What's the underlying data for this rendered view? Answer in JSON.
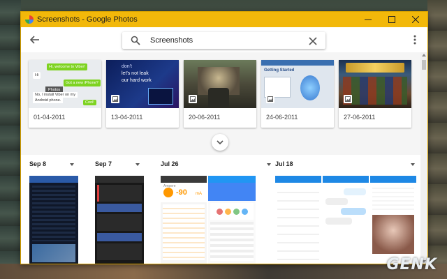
{
  "window": {
    "title": "Screenshots - Google Photos"
  },
  "toolbar": {
    "search_value": "Screenshots"
  },
  "albums": [
    {
      "date": "01-04-2011",
      "thumb_text": [
        "Hi, welcome to Viber!",
        "Hi",
        "Got a new iPhone?",
        "Photos",
        "No, I install Viber on my",
        "Android phone.",
        "Cool!"
      ]
    },
    {
      "date": "13-04-2011",
      "thumb_text": [
        "don't",
        "let's not leak",
        "our hard work"
      ]
    },
    {
      "date": "20-06-2011"
    },
    {
      "date": "24-06-2011",
      "thumb_text": [
        "Getting Started"
      ]
    },
    {
      "date": "27-06-2011"
    }
  ],
  "date_groups": [
    {
      "label": "Sep 8"
    },
    {
      "label": "Sep 7"
    },
    {
      "label": "Jul 26"
    },
    {
      "label": "Jul 18"
    }
  ],
  "screenshot_text": {
    "speed": "-90",
    "speed_unit": "mA",
    "app": "Ampere"
  },
  "colors": {
    "titlebar": "#f2b80a",
    "accent_blue": "#1e88e5"
  },
  "watermark": "GENK"
}
